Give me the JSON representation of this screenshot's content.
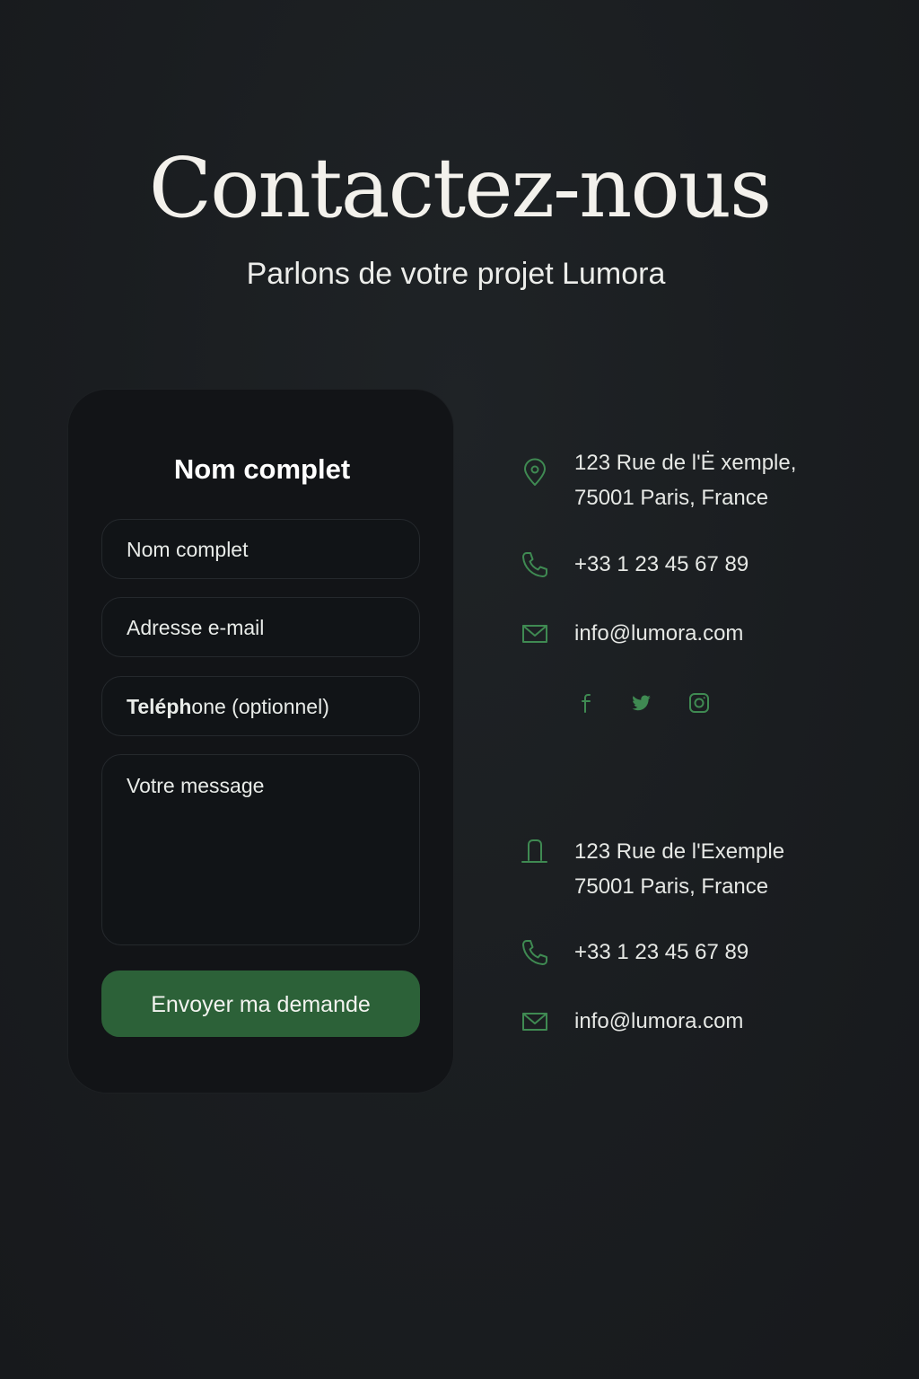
{
  "hero": {
    "title": "Contactez-nous",
    "subtitle": "Parlons de votre projet Lumora"
  },
  "form": {
    "heading": "Nom complet",
    "fields": {
      "name_placeholder": "Nom complet",
      "email_placeholder": "Adresse e-mail",
      "phone_bold": "Teléph",
      "phone_rest": "one (optionnel)",
      "message_placeholder": "Votre message"
    },
    "submit_label": "Envoyer ma demande"
  },
  "contact_primary": {
    "address_line1": "123 Rue de l'Ė xemple,",
    "address_line2": "75001 Paris, France",
    "phone": "+33 1 23 45 67 89",
    "email": "info@lumora.com"
  },
  "social": [
    "facebook-icon",
    "twitter-icon",
    "instagram-icon"
  ],
  "contact_secondary": {
    "address_line1": "123  Rue de l'Exemple",
    "address_line2": "75001 Paris, France",
    "phone": "+33 1 23 45 67 89",
    "email": "info@lumora.com"
  },
  "colors": {
    "background": "#1a1d20",
    "card": "#121417",
    "accent": "#2c6138",
    "icon": "#3f8a52"
  }
}
